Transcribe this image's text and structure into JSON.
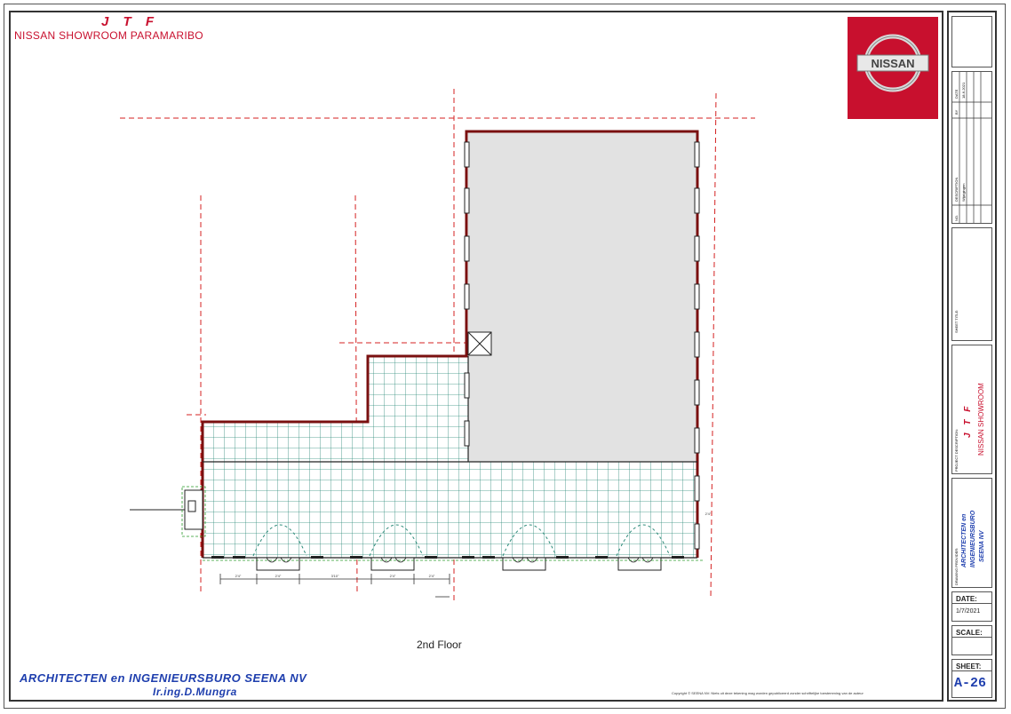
{
  "header": {
    "company_initials": "J T F",
    "project_name": "NISSAN SHOWROOM PARAMARIBO"
  },
  "logo": {
    "text": "NISSAN",
    "color": "#c8102e"
  },
  "drawing": {
    "floor_label": "2nd Floor",
    "dimensions": [
      "2'4\"",
      "2'4\"",
      "3'10\"",
      "2'4\"",
      "2'4\"",
      "2'4\""
    ]
  },
  "footer": {
    "firm": "ARCHITECTEN en INGENIEURSBURO SEENA NV",
    "engineer": "Ir.ing.D.Mungra",
    "copyright": "Copyright © SEENA NV: Niets uit deze tekening mag worden gepubliceerd zonder schriftelijke toestemming van de auteur"
  },
  "title_block": {
    "rev_headers": [
      "DATE",
      "BY",
      "DESCRIPTION",
      "NO."
    ],
    "rev_date": "18-6-2021",
    "rev_desc": "Wijzigingen",
    "sheet_title_label": "SHEET TITLE:",
    "project_desc_label": "PROJECT DESCRIPTION:",
    "project_desc_line1": "J T F",
    "project_desc_line2": "NISSAN SHOWROOM",
    "drawing_provider_label": "DRAWING PROVIDER:",
    "provider_line1": "ARCHITECTEN  en",
    "provider_line2": "INGENIEURSBURO",
    "provider_line3": "SEENA NV",
    "date_label": "DATE:",
    "date_value": "1/7/2021",
    "scale_label": "SCALE:",
    "scale_value": "",
    "sheet_label": "SHEET:",
    "sheet_value": "A-26"
  },
  "colors": {
    "accent_red": "#c8102e",
    "grid_teal": "#2e8b7a",
    "wall": "#7a1010",
    "firm_blue": "#1f3fae",
    "slab_gray": "#e2e2e2"
  }
}
